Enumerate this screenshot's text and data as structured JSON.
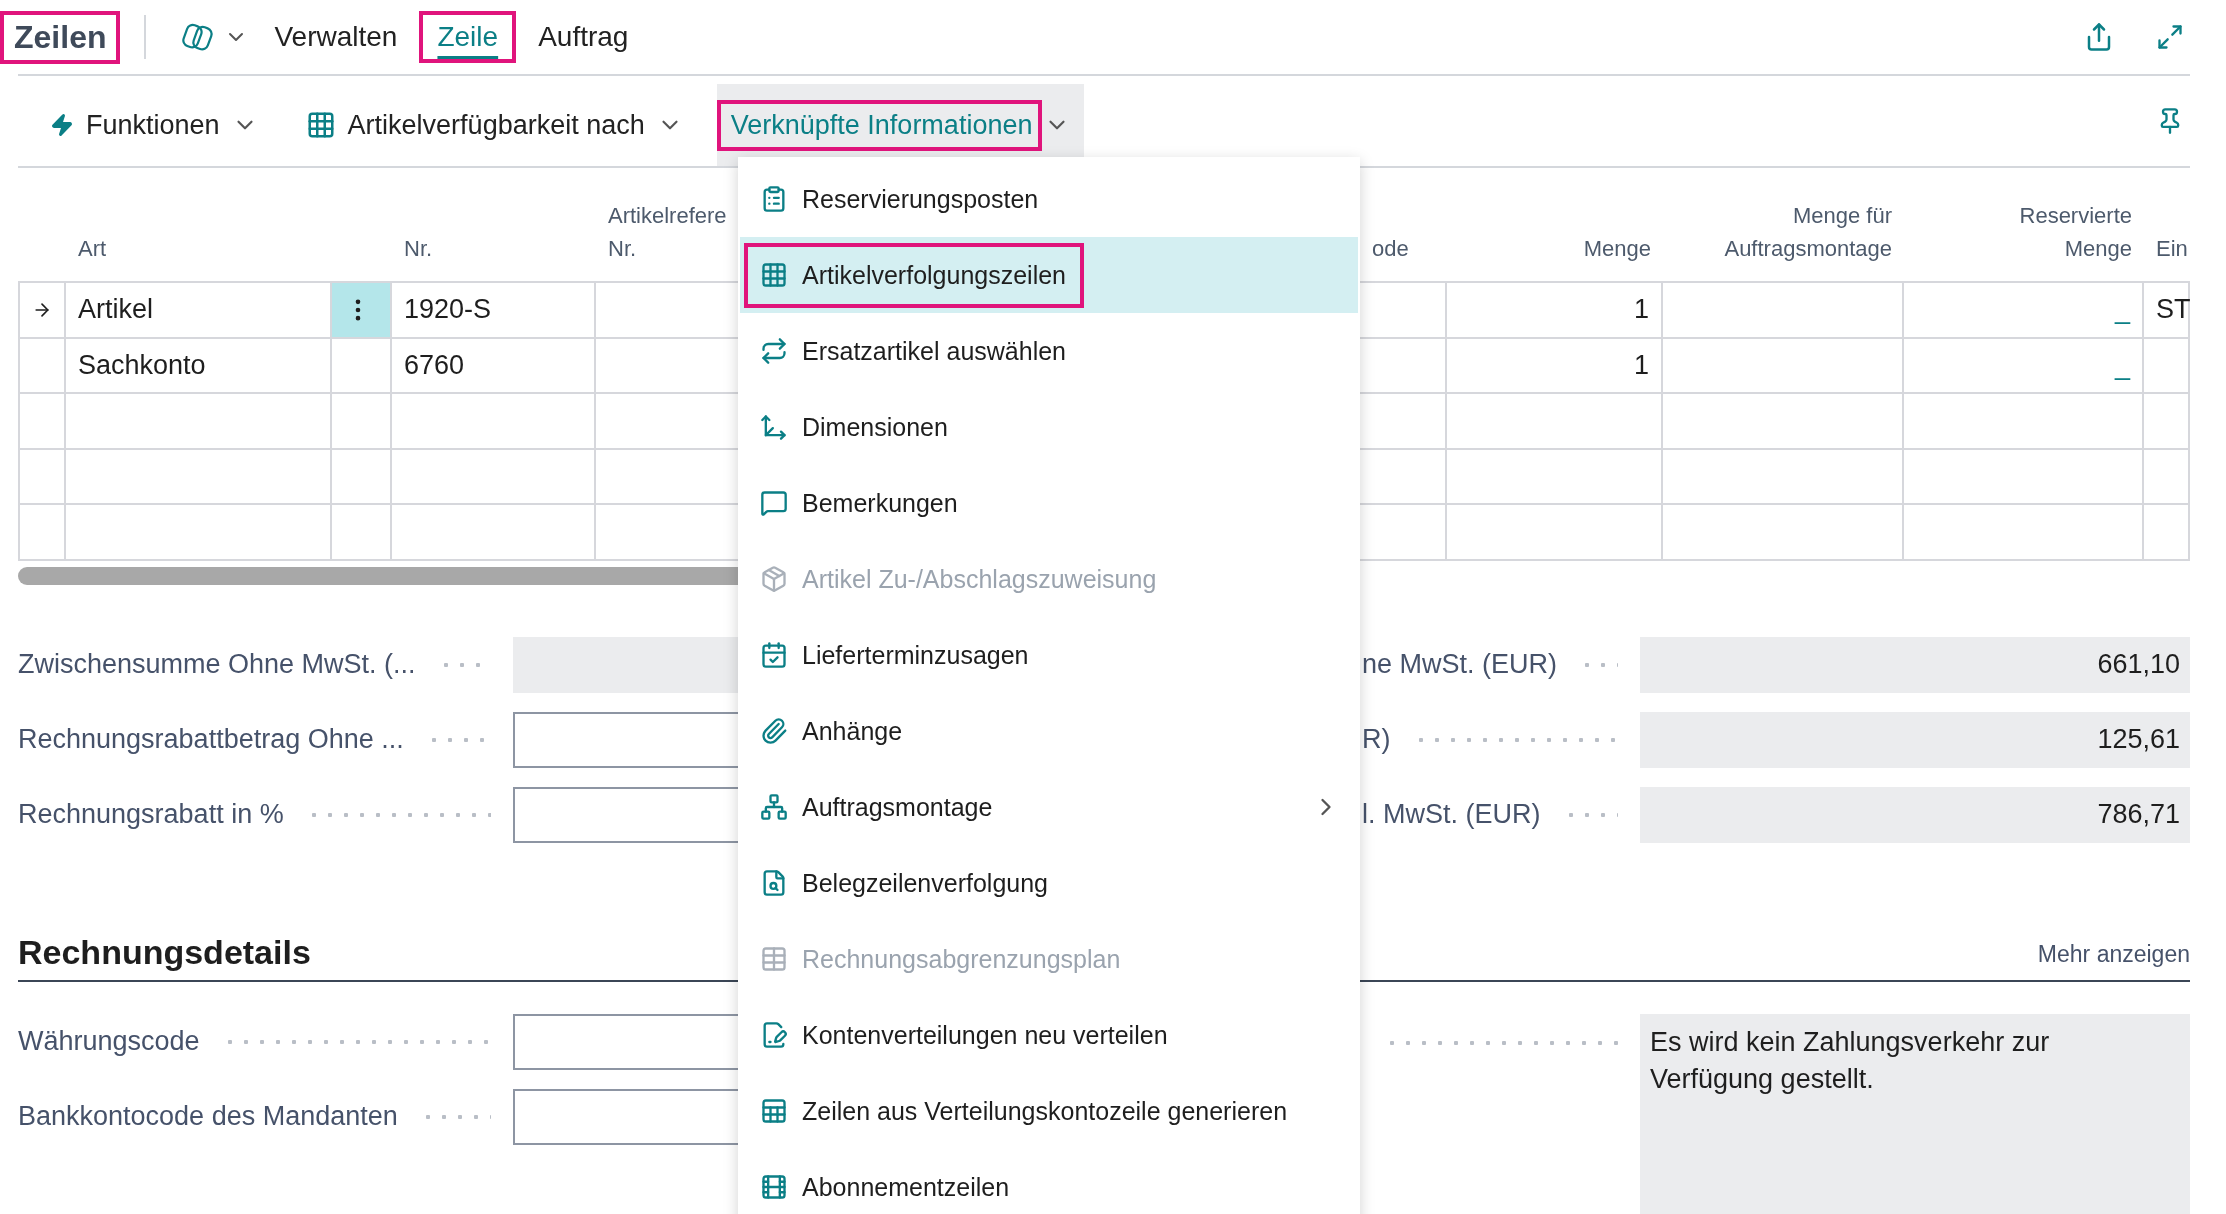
{
  "page": {
    "title": "Zeilen",
    "highlighted": true
  },
  "tabs": [
    {
      "label": "Verwalten",
      "selected": false,
      "highlighted": false
    },
    {
      "label": "Zeile",
      "selected": true,
      "highlighted": true
    },
    {
      "label": "Auftrag",
      "selected": false,
      "highlighted": false
    }
  ],
  "actions": [
    {
      "label": "Funktionen",
      "expanded": false,
      "highlighted": false
    },
    {
      "label": "Artikelverfügbarkeit nach",
      "expanded": false,
      "highlighted": false
    },
    {
      "label": "Verknüpfte Informationen",
      "expanded": true,
      "highlighted": true
    }
  ],
  "table": {
    "columns": [
      "Art",
      "Nr.",
      "Artikelrefere Nr.",
      "ode",
      "Menge",
      "Menge für Auftragsmontage",
      "Reservierte Menge",
      "Ein"
    ],
    "rows": [
      {
        "current": true,
        "cells": [
          "Artikel",
          "1920-S",
          null,
          null,
          "1",
          null,
          "_",
          "ST"
        ]
      },
      {
        "current": false,
        "cells": [
          "Sachkonto",
          "6760",
          null,
          null,
          "1",
          null,
          "_",
          null
        ]
      },
      {
        "current": false,
        "cells": [
          null,
          null,
          null,
          null,
          null,
          null,
          null,
          null
        ]
      },
      {
        "current": false,
        "cells": [
          null,
          null,
          null,
          null,
          null,
          null,
          null,
          null
        ]
      },
      {
        "current": false,
        "cells": [
          null,
          null,
          null,
          null,
          null,
          null,
          null,
          null
        ]
      }
    ]
  },
  "totals": {
    "left": [
      {
        "label": "Zwischensumme Ohne MwSt. (...",
        "kind": "readonly"
      },
      {
        "label": "Rechnungsrabattbetrag Ohne ...",
        "kind": "input"
      },
      {
        "label": "Rechnungsrabatt in %",
        "kind": "input"
      }
    ],
    "right": [
      {
        "label": "ne MwSt. (EUR)",
        "value": "661,10"
      },
      {
        "label": "R)",
        "value": "125,61"
      },
      {
        "label": "l. MwSt. (EUR)",
        "value": "786,71"
      }
    ]
  },
  "details": {
    "heading": "Rechnungsdetails",
    "more_link": "Mehr anzeigen",
    "fields": [
      {
        "label": "Währungscode"
      },
      {
        "label": "Bankkontocode des Mandanten"
      }
    ],
    "note": "Es wird kein Zahlungsverkehr zur Verfügung gestellt."
  },
  "menu": {
    "items": [
      {
        "label": "Reservierungsposten",
        "disabled": false,
        "selected": false,
        "highlighted": false,
        "submenu": false
      },
      {
        "label": "Artikelverfolgungszeilen",
        "disabled": false,
        "selected": true,
        "highlighted": true,
        "submenu": false
      },
      {
        "label": "Ersatzartikel auswählen",
        "disabled": false,
        "selected": false,
        "highlighted": false,
        "submenu": false
      },
      {
        "label": "Dimensionen",
        "disabled": false,
        "selected": false,
        "highlighted": false,
        "submenu": false
      },
      {
        "label": "Bemerkungen",
        "disabled": false,
        "selected": false,
        "highlighted": false,
        "submenu": false
      },
      {
        "label": "Artikel Zu-/Abschlagszuweisung",
        "disabled": true,
        "selected": false,
        "highlighted": false,
        "submenu": false
      },
      {
        "label": "Lieferterminzusagen",
        "disabled": false,
        "selected": false,
        "highlighted": false,
        "submenu": false
      },
      {
        "label": "Anhänge",
        "disabled": false,
        "selected": false,
        "highlighted": false,
        "submenu": false
      },
      {
        "label": "Auftragsmontage",
        "disabled": false,
        "selected": false,
        "highlighted": false,
        "submenu": true
      },
      {
        "label": "Belegzeilenverfolgung",
        "disabled": false,
        "selected": false,
        "highlighted": false,
        "submenu": false
      },
      {
        "label": "Rechnungsabgrenzungsplan",
        "disabled": true,
        "selected": false,
        "highlighted": false,
        "submenu": false
      },
      {
        "label": "Kontenverteilungen neu verteilen",
        "disabled": false,
        "selected": false,
        "highlighted": false,
        "submenu": false
      },
      {
        "label": "Zeilen aus Verteilungskontozeile generieren",
        "disabled": false,
        "selected": false,
        "highlighted": false,
        "submenu": false
      },
      {
        "label": "Abonnementzeilen",
        "disabled": false,
        "selected": false,
        "highlighted": false,
        "submenu": false
      }
    ]
  }
}
